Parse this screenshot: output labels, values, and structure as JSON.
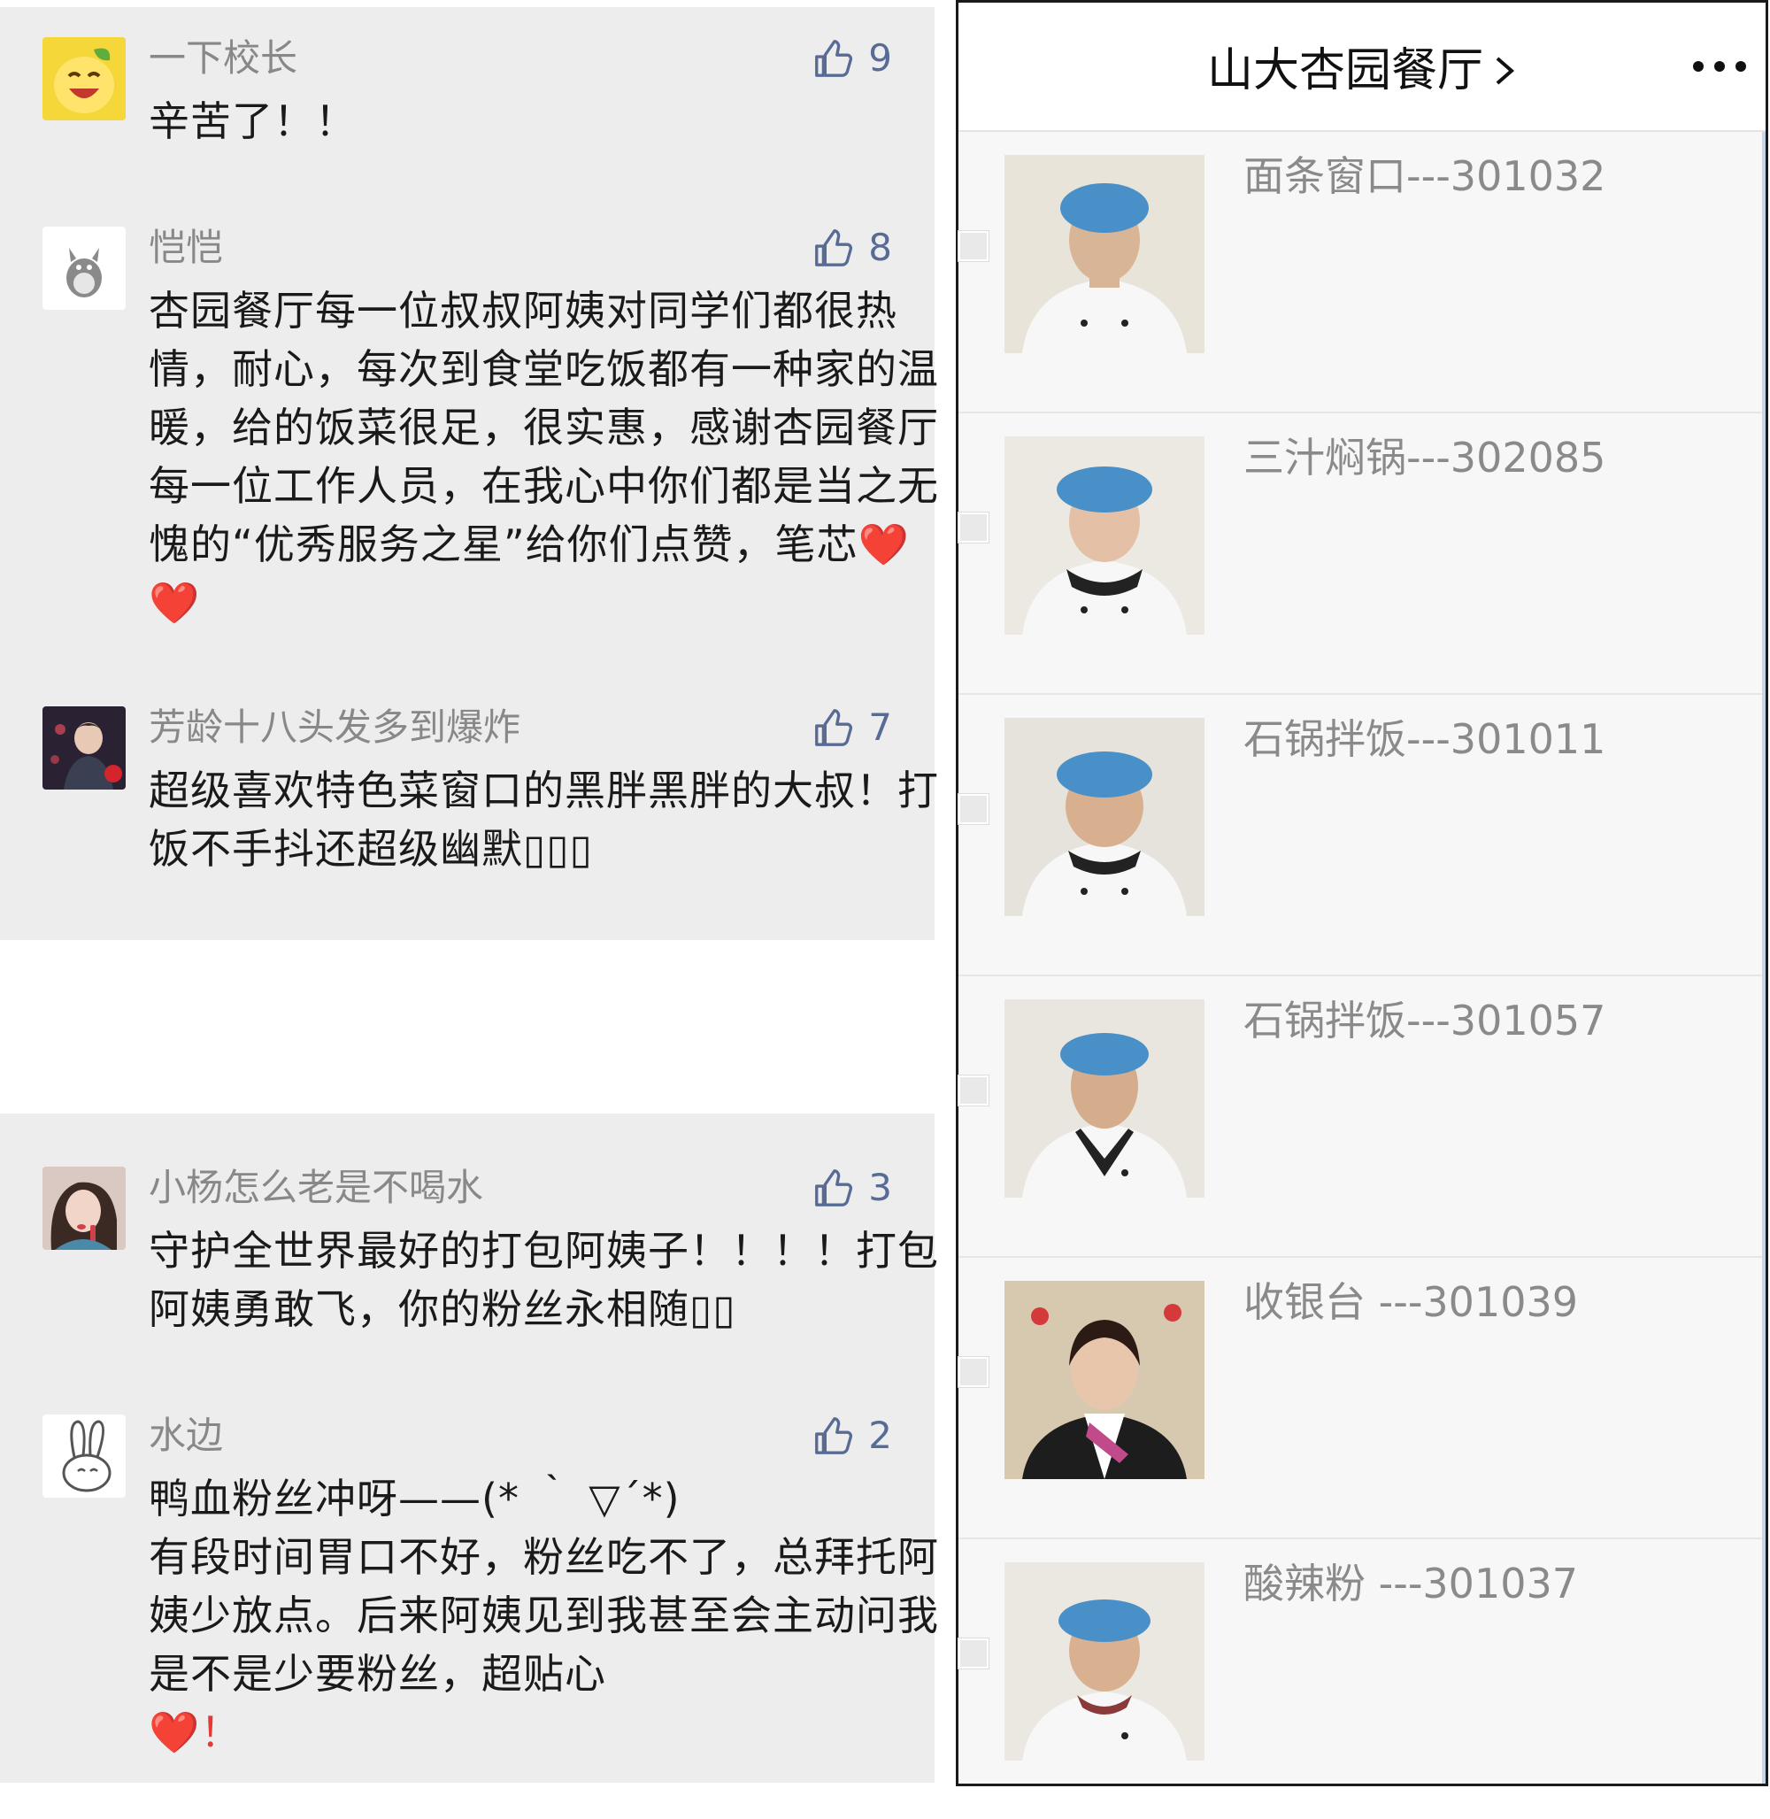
{
  "comments_top": [
    {
      "user": "一下校长",
      "likes": "9",
      "text": "辛苦了！！"
    },
    {
      "user": "恺恺",
      "likes": "8",
      "text": "杏园餐厅每一位叔叔阿姨对同学们都很热情，耐心，每次到食堂吃饭都有一种家的温暖，给的饭菜很足，很实惠，感谢杏园餐厅每一位工作人员，在我心中你们都是当之无愧的“优秀服务之星”给你们点赞，笔芯",
      "emoji": "❤️❤️"
    },
    {
      "user": "芳龄十八头发多到爆炸",
      "likes": "7",
      "text": "超级喜欢特色菜窗口的黑胖黑胖的大叔！打饭不手抖还超级幽默▯▯▯"
    }
  ],
  "comments_bottom": [
    {
      "user": "小杨怎么老是不喝水",
      "likes": "3",
      "text": "守护全世界最好的打包阿姨子！！！！打包阿姨勇敢飞，你的粉丝永相随▯▯"
    },
    {
      "user": "水边",
      "likes": "2",
      "text": "鸭血粉丝冲呀——(* ｀ ▽´*)\n有段时间胃口不好，粉丝吃不了，总拜托阿姨少放点。后来阿姨见到我甚至会主动问我是不是少要粉丝，超贴心\n",
      "emoji": "❤️！"
    }
  ],
  "right_panel": {
    "title": "山大杏园餐厅",
    "staff": [
      {
        "label": "面条窗口---301032"
      },
      {
        "label": "三汁焖锅---302085"
      },
      {
        "label": "石锅拌饭---301011"
      },
      {
        "label": "石锅拌饭---301057"
      },
      {
        "label": "收银台 ---301039"
      },
      {
        "label": "酸辣粉 ---301037"
      }
    ]
  },
  "icons": {
    "like": "thumbs-up-icon",
    "more": "more-dots-icon",
    "chevron": "chevron-right-icon"
  },
  "colors": {
    "panel_bg": "#ededed",
    "like_blue": "#576b95",
    "name_gray": "#888888",
    "text_dark": "#1a1a1a"
  }
}
